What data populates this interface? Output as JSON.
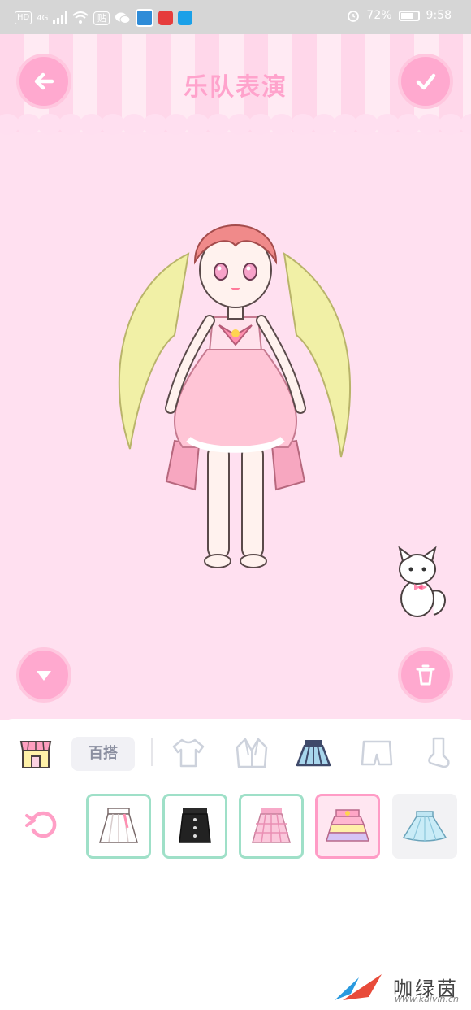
{
  "status_bar": {
    "network_badge": "HD",
    "signal_type": "4G",
    "app_badge": "贴",
    "battery_percent": "72%",
    "time": "9:58",
    "battery_level": 0.72
  },
  "header": {
    "title": "乐队表演",
    "back_icon": "arrow-left-icon",
    "confirm_icon": "checkmark-icon"
  },
  "toolbar": {
    "collapse_icon": "chevron-down-icon",
    "delete_icon": "trash-icon"
  },
  "categories": {
    "shop_icon": "shop-icon",
    "combo_label": "百搭",
    "items": [
      {
        "icon": "shirt-icon",
        "selected": false
      },
      {
        "icon": "jacket-icon",
        "selected": false
      },
      {
        "icon": "skirt-icon",
        "selected": true
      },
      {
        "icon": "shorts-icon",
        "selected": false
      },
      {
        "icon": "sock-icon",
        "selected": false
      }
    ]
  },
  "items_row": {
    "reset_icon": "rotate-reset-icon",
    "items": [
      {
        "name": "white-pleated-skirt",
        "state": "owned"
      },
      {
        "name": "black-button-skirt",
        "state": "owned"
      },
      {
        "name": "pink-plaid-skirt",
        "state": "owned"
      },
      {
        "name": "pastel-tiered-skirt",
        "state": "selected"
      },
      {
        "name": "light-blue-skirt",
        "state": "locked"
      }
    ]
  },
  "colors": {
    "accent": "#ffa9cf",
    "stage_bg": "#ffe0f0",
    "owned_border": "#9fe0c8",
    "selected_border": "#ff9cc6"
  },
  "watermark": {
    "text": "咖绿茵",
    "url": "www.kalvin.cn"
  }
}
